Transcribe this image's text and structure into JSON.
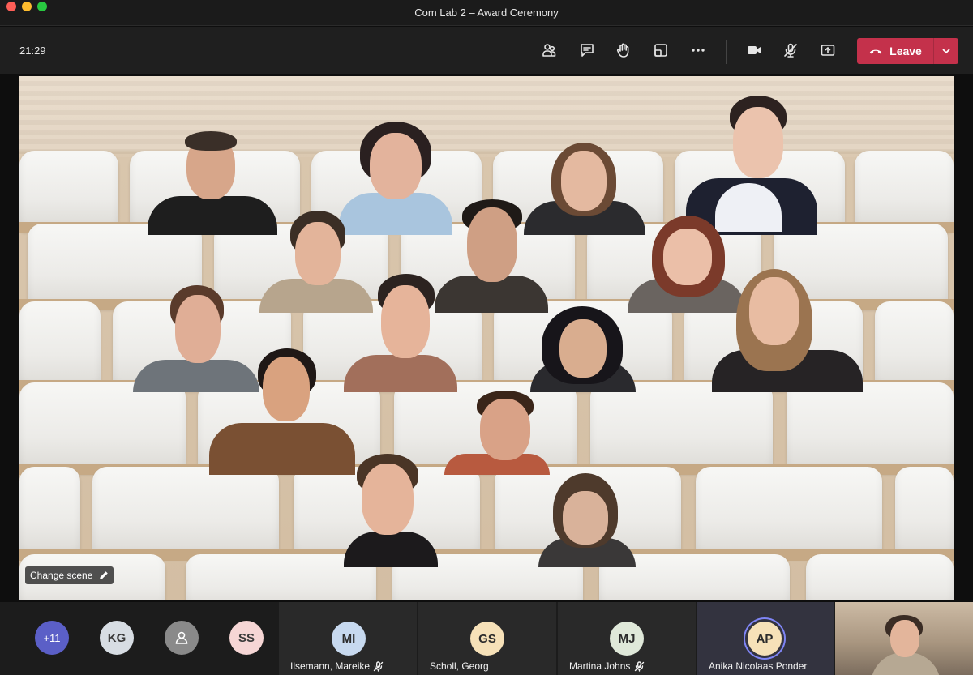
{
  "window": {
    "title": "Com Lab 2 – Award Ceremony"
  },
  "toolbar": {
    "clock": "21:29",
    "buttons": {
      "participants": "participants-icon",
      "chat": "chat-icon",
      "raise_hand": "hand-icon",
      "rooms": "breakout-icon",
      "more": "more-icon",
      "camera": "camera-icon",
      "mic": "mic-off-icon",
      "share": "share-icon"
    },
    "leave_label": "Leave",
    "leave_color": "#c4314b"
  },
  "stage": {
    "change_scene_label": "Change scene"
  },
  "strip": {
    "overflow_count": "+11",
    "avatars": [
      {
        "initials": "KG",
        "bg": "#d7dde3",
        "fg": "#3a3a3a"
      },
      {
        "initials": "",
        "bg": "#8a8a8a",
        "fg": "#ffffff"
      },
      {
        "initials": "SS",
        "bg": "#f6d6d5",
        "fg": "#3a3a3a"
      }
    ],
    "tiles": [
      {
        "initials": "MI",
        "name": "Ilsemann, Mareike",
        "bg": "#c7d9ef",
        "muted": true
      },
      {
        "initials": "GS",
        "name": "Scholl, Georg",
        "bg": "#f6e1b8",
        "muted": false
      },
      {
        "initials": "MJ",
        "name": "Martina Johns",
        "bg": "#dfe8d9",
        "muted": true
      },
      {
        "initials": "AP",
        "name": "Anika Nicolaas Ponder",
        "bg": "#f6e1b8",
        "muted": false,
        "speaking": true
      }
    ],
    "overflow_bg": "#5b5fc7"
  }
}
